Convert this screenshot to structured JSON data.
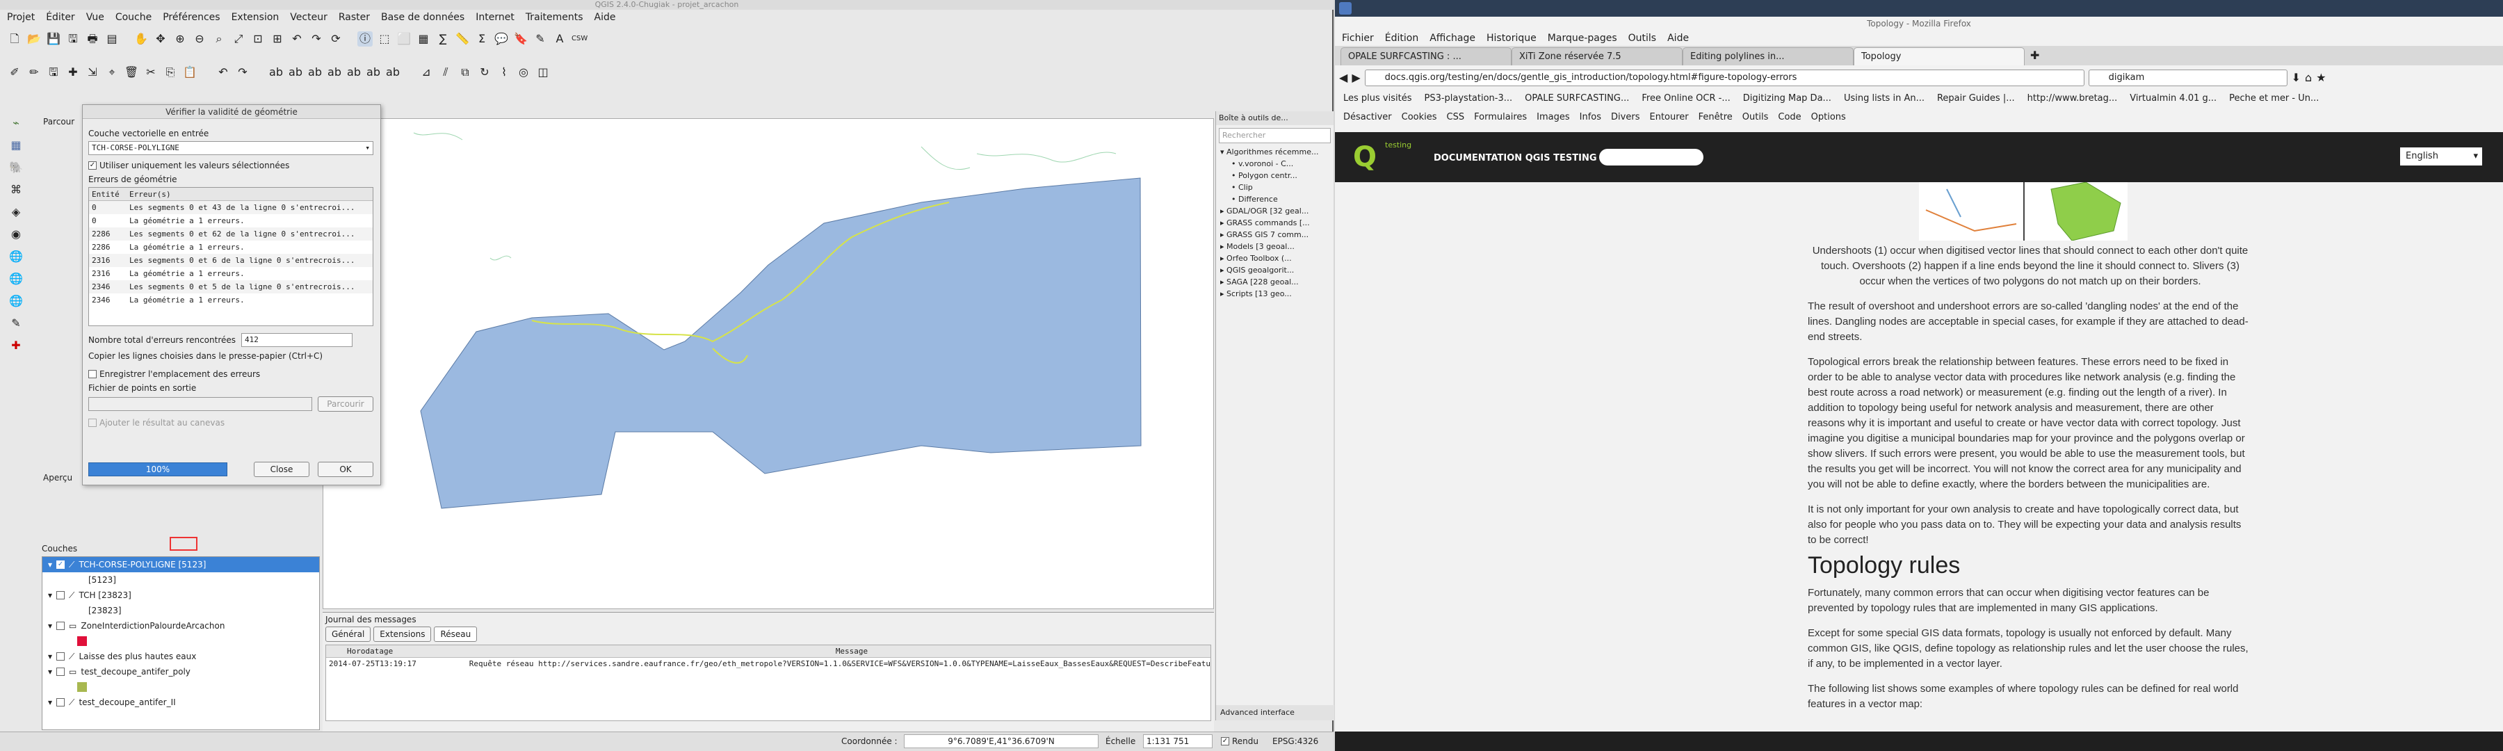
{
  "qgis": {
    "title": "QGIS 2.4.0-Chugiak - projet_arcachon",
    "menu": [
      "Projet",
      "Éditer",
      "Vue",
      "Couche",
      "Préférences",
      "Extension",
      "Vecteur",
      "Raster",
      "Base de données",
      "Internet",
      "Traitements",
      "Aide"
    ],
    "side_panel_label": "Parcour",
    "overview_label": "Aperçu",
    "dialog": {
      "title": "Vérifier la validité de géométrie",
      "input_label": "Couche vectorielle en entrée",
      "input_value": "TCH-CORSE-POLYLIGNE",
      "selected_only": "Utiliser uniquement les valeurs sélectionnées",
      "errors_label": "Erreurs de géométrie",
      "col_entity": "Entité",
      "col_errors": "Erreur(s)",
      "rows": [
        [
          "0",
          "Les segments 0 et 43 de la ligne 0 s'entrecroi..."
        ],
        [
          "0",
          "La géométrie a 1 erreurs."
        ],
        [
          "2286",
          "Les segments 0 et 62 de la ligne 0 s'entrecroi..."
        ],
        [
          "2286",
          "La géométrie a 1 erreurs."
        ],
        [
          "2316",
          "Les segments 0 et 6 de la ligne 0 s'entrecrois..."
        ],
        [
          "2316",
          "La géométrie a 1 erreurs."
        ],
        [
          "2346",
          "Les segments 0 et 5 de la ligne 0 s'entrecrois..."
        ],
        [
          "2346",
          "La géométrie a 1 erreurs."
        ]
      ],
      "total_label": "Nombre total d'erreurs rencontrées",
      "total_value": "412",
      "copy_hint": "Copier les lignes choisies dans le presse-papier (Ctrl+C)",
      "save_location": "Enregistrer l'emplacement des erreurs",
      "output_file_label": "Fichier de points en sortie",
      "browse": "Parcourir",
      "add_result": "Ajouter le résultat au canevas",
      "progress": "100%",
      "close": "Close",
      "ok": "OK"
    },
    "toolbox": {
      "title": "Boîte à outils de...",
      "search_placeholder": "Rechercher",
      "items": [
        "Algorithmes récemme...",
        "v.voronoi - C...",
        "Polygon centr...",
        "Clip",
        "Difference",
        "GDAL/OGR [32 geal...",
        "GRASS commands [...",
        "GRASS GIS 7 comm...",
        "Models [3 geoal...",
        "Orfeo Toolbox (...",
        "QGIS geoalgorit...",
        "SAGA [228 geoal...",
        "Scripts [13 geo..."
      ],
      "advanced": "Advanced interface"
    },
    "layers": {
      "title": "Couches",
      "items": [
        "TCH-CORSE-POLYLIGNE [5123]",
        "[5123]",
        "TCH [23823]",
        "[23823]",
        "ZoneInterdictionPalourdeArcachon",
        "",
        "Laisse des plus hautes eaux",
        "test_decoupe_antifer_poly",
        "",
        "test_decoupe_antifer_II"
      ]
    },
    "messages": {
      "title": "Journal des messages",
      "tabs": [
        "Général",
        "Extensions",
        "Réseau"
      ],
      "col_time": "Horodatage",
      "col_msg": "Message",
      "line_time": "2014-07-25T13:19:17",
      "line_msg": "Requête réseau http://services.sandre.eaufrance.fr/geo/eth_metropole?VERSION=1.1.0&SERVICE=WFS&VERSION=1.0.0&TYPENAME=LaisseEaux_BassesEaux&REQUEST=DescribeFeatu"
    },
    "status": {
      "coord_label": "Coordonnée :",
      "coord_value": "9°6.7089'E,41°36.6709'N",
      "scale_label": "Échelle",
      "scale_value": "1:131 751",
      "render": "Rendu",
      "epsg": "EPSG:4326"
    }
  },
  "firefox": {
    "title": "Topology - Mozilla Firefox",
    "menu": [
      "Fichier",
      "Édition",
      "Affichage",
      "Historique",
      "Marque-pages",
      "Outils",
      "Aide"
    ],
    "tabs": [
      "OPALE SURFCASTING : ...",
      "XiTi Zone réservée 7.5",
      "Editing polylines in...",
      "Topology"
    ],
    "url": "docs.qgis.org/testing/en/docs/gentle_gis_introduction/topology.html#figure-topology-errors",
    "search": "digikam",
    "bookmarks": [
      "Les plus visités",
      "PS3-playstation-3...",
      "OPALE SURFCASTING...",
      "Free Online OCR -...",
      "Digitizing Map Da...",
      "Using lists in An...",
      "Repair Guides |...",
      "http://www.bretag...",
      "Virtualmin 4.01 g...",
      "Peche et mer - Un..."
    ],
    "webdev": [
      "Désactiver",
      "Cookies",
      "CSS",
      "Formulaires",
      "Images",
      "Infos",
      "Divers",
      "Entourer",
      "Fenêtre",
      "Outils",
      "Code",
      "Options"
    ],
    "doc_header": "DOCUMENTATION QGIS TESTING",
    "logo_sub": "testing",
    "language": "English",
    "p1": "Undershoots (1) occur when digitised vector lines that should connect to each other don't quite touch. Overshoots (2) happen if a line ends beyond the line it should connect to. Slivers (3) occur when the vertices of two polygons do not match up on their borders.",
    "p2": "The result of overshoot and undershoot errors are so-called 'dangling nodes' at the end of the lines. Dangling nodes are acceptable in special cases, for example if they are attached to dead-end streets.",
    "p3": "Topological errors break the relationship between features. These errors need to be fixed in order to be able to analyse vector data with procedures like network analysis (e.g. finding the best route across a road network) or measurement (e.g. finding out the length of a river). In addition to topology being useful for network analysis and measurement, there are other reasons why it is important and useful to create or have vector data with correct topology. Just imagine you digitise a municipal boundaries map for your province and the polygons overlap or show slivers. If such errors were present, you would be able to use the measurement tools, but the results you get will be incorrect. You will not know the correct area for any municipality and you will not be able to define exactly, where the borders between the municipalities are.",
    "p4": "It is not only important for your own analysis to create and have topologically correct data, but also for people who you pass data on to. They will be expecting your data and analysis results to be correct!",
    "h2": "Topology rules",
    "p5": "Fortunately, many common errors that can occur when digitising vector features can be prevented by topology rules that are implemented in many GIS applications.",
    "p6": "Except for some special GIS data formats, topology is usually not enforced by default. Many common GIS, like QGIS, define topology as relationship rules and let the user choose the rules, if any, to be implemented in a vector layer.",
    "p7": "The following list shows some examples of where topology rules can be defined for real world features in a vector map:"
  }
}
